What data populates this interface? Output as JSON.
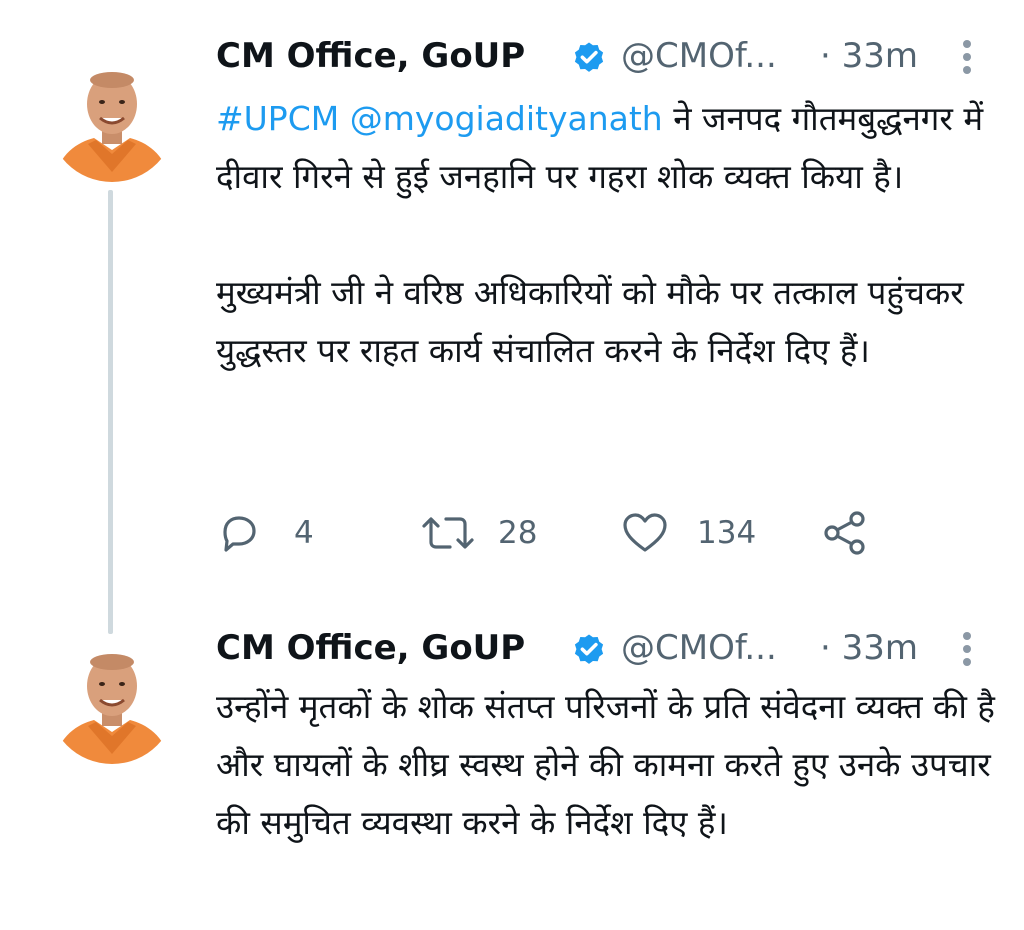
{
  "tweets": [
    {
      "author_name": "CM Office, GoUP",
      "handle": "@CMOf...",
      "time": "· 33m",
      "mention_hashtag": "#UPCM",
      "mention_user": "@myogiadityanath",
      "text_line1_rest": " ने जनपद गौतमबुद्धनगर में दीवार गिरने से हुई जनहानि पर गहरा शोक व्यक्त किया है।",
      "text_para2": "मुख्यमंत्री जी ने वरिष्ठ अधिकारियों को मौके पर तत्काल पहुंचकर युद्धस्तर पर राहत कार्य संचालित करने के निर्देश दिए हैं।",
      "reply_count": "4",
      "retweet_count": "28",
      "like_count": "134"
    },
    {
      "author_name": "CM Office, GoUP",
      "handle": "@CMOf...",
      "time": "· 33m",
      "text": "उन्होंने मृतकों के शोक संतप्त परिजनों के प्रति संवेदना व्यक्त की है और घायलों के शीघ्र स्वस्थ होने की कामना करते हुए उनके उपचार की समुचित व्यवस्था करने के निर्देश दिए हैं।"
    }
  ],
  "icons": {
    "verified": "verified-badge-icon",
    "more": "more-options-icon",
    "reply": "reply-icon",
    "retweet": "retweet-icon",
    "like": "like-icon",
    "share": "share-icon"
  },
  "colors": {
    "link": "#1d9bf0",
    "secondary_text": "#536471",
    "thread_line": "#cfd9de",
    "robe": "#f08a3c"
  }
}
